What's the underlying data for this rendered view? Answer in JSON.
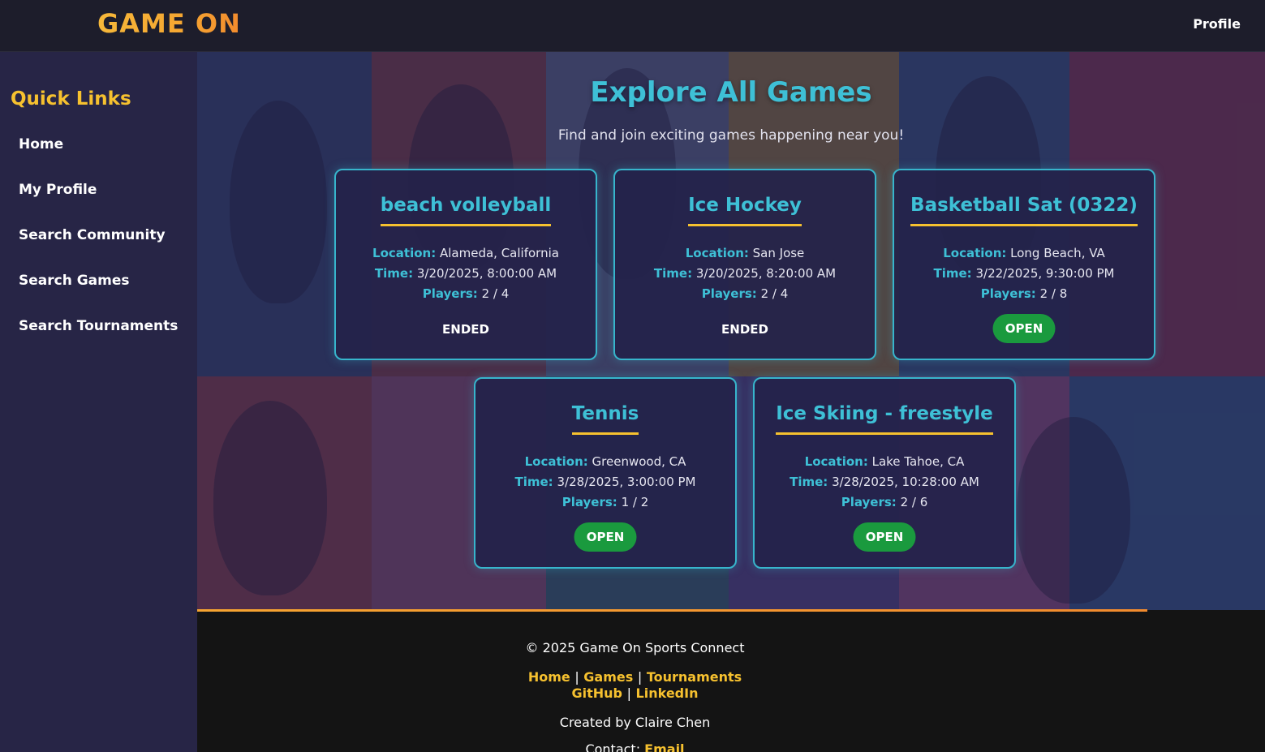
{
  "header": {
    "logo": "GAME ON",
    "profile_label": "Profile"
  },
  "sidebar": {
    "title": "Quick Links",
    "items": [
      {
        "label": "Home"
      },
      {
        "label": "My Profile"
      },
      {
        "label": "Search Community"
      },
      {
        "label": "Search Games"
      },
      {
        "label": "Search Tournaments"
      }
    ]
  },
  "main": {
    "title": "Explore All Games",
    "subtitle": "Find and join exciting games happening near you!",
    "labels": {
      "location": "Location:",
      "time": "Time:",
      "players": "Players:"
    },
    "games": [
      {
        "title": "beach volleyball",
        "location": "Alameda, California",
        "time": "3/20/2025, 8:00:00 AM",
        "players": "2 / 4",
        "status": "ENDED"
      },
      {
        "title": "Ice Hockey",
        "location": "San Jose",
        "time": "3/20/2025, 8:20:00 AM",
        "players": "2 / 4",
        "status": "ENDED"
      },
      {
        "title": "Basketball Sat (0322)",
        "location": "Long Beach, VA",
        "time": "3/22/2025, 9:30:00 PM",
        "players": "2 / 8",
        "status": "OPEN"
      },
      {
        "title": "Tennis",
        "location": "Greenwood, CA",
        "time": "3/28/2025, 3:00:00 PM",
        "players": "1 / 2",
        "status": "OPEN"
      },
      {
        "title": "Ice Skiing - freestyle",
        "location": "Lake Tahoe, CA",
        "time": "3/28/2025, 10:28:00 AM",
        "players": "2 / 6",
        "status": "OPEN"
      }
    ]
  },
  "footer": {
    "copyright": "© 2025 Game On Sports Connect",
    "links_row1": [
      "Home",
      "Games",
      "Tournaments"
    ],
    "links_row2": [
      "GitHub",
      "LinkedIn"
    ],
    "separator": "|",
    "credit": "Created by Claire Chen",
    "contact_label": "Contact:",
    "contact_link": "Email"
  },
  "colors": {
    "accent_teal": "#3ec0d6",
    "accent_yellow": "#f6c12f",
    "logo_orange": "#f5a631",
    "sidebar_bg": "#272546",
    "topbar_bg": "#1d1d2b",
    "open_green": "#1a9a3e",
    "footer_bg": "#141414"
  }
}
